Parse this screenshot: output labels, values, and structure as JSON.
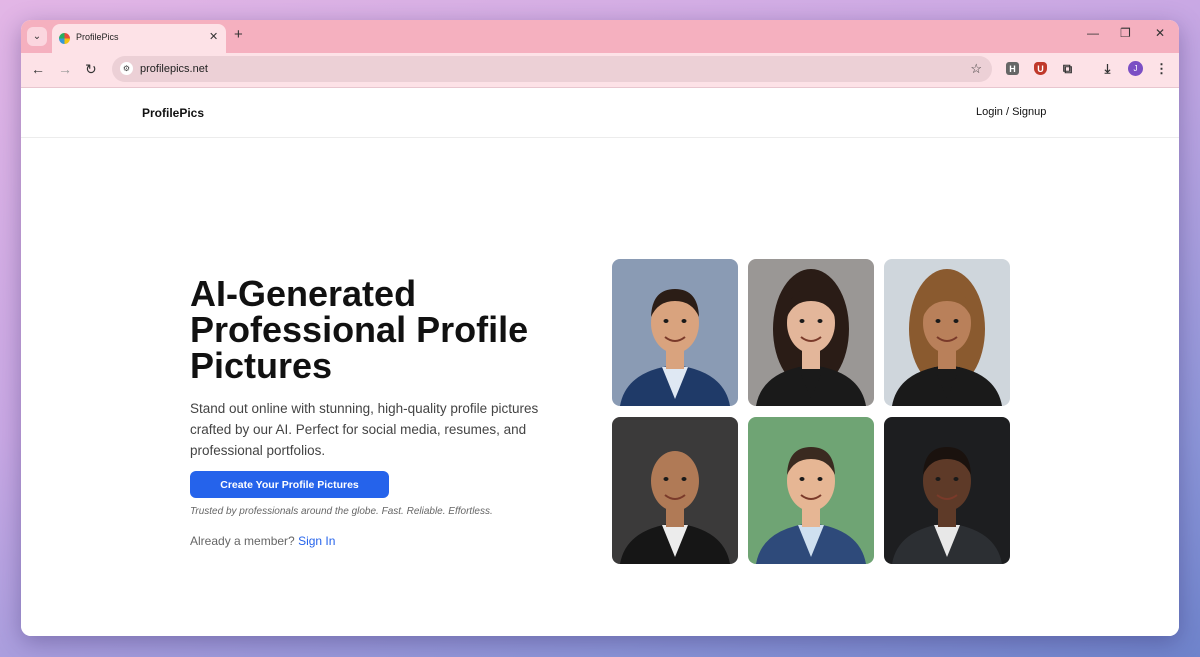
{
  "browser": {
    "tab_title": "ProfilePics",
    "url": "profilepics.net",
    "avatar_initial": "J",
    "extension_h": "H",
    "extension_shield": "U"
  },
  "site": {
    "brand": "ProfilePics",
    "login_label": "Login / Signup"
  },
  "hero": {
    "title": "AI-Generated Professional Profile Pictures",
    "subtitle": "Stand out online with stunning, high-quality profile pictures crafted by our AI. Perfect for social media, resumes, and professional portfolios.",
    "cta_label": "Create Your Profile Pictures",
    "trust_line": "Trusted by professionals around the globe. Fast. Reliable. Effortless.",
    "member_prompt": "Already a member?",
    "signin_label": "Sign In"
  },
  "colors": {
    "accent": "#2563eb",
    "tabstrip": "#f5b0bf",
    "toolbar": "#fde2e7"
  },
  "portraits": [
    {
      "name": "portrait-man-blue-suit",
      "bg": "#8a9bb4",
      "skin": "#d9a37e",
      "hair": "#2b1d16",
      "suit": "#1f3a68",
      "shirt": "#dfe8f3"
    },
    {
      "name": "portrait-woman-dark-hair",
      "bg": "#9a9795",
      "skin": "#e3b69a",
      "hair": "#2a1c16",
      "suit": "#1a1a1a",
      "shirt": "#1a1a1a"
    },
    {
      "name": "portrait-woman-wavy-hair",
      "bg": "#cfd6dc",
      "skin": "#b9805a",
      "hair": "#8a5a2f",
      "suit": "#1a1a1a",
      "shirt": "#1a1a1a"
    },
    {
      "name": "portrait-bald-man",
      "bg": "#3b3a3a",
      "skin": "#b07a56",
      "hair": "#b07a56",
      "suit": "#161616",
      "shirt": "#ececec"
    },
    {
      "name": "portrait-young-man-smiling",
      "bg": "#6fa474",
      "skin": "#e6b694",
      "hair": "#3a2a20",
      "suit": "#2e4a7a",
      "shirt": "#cfe0f0"
    },
    {
      "name": "portrait-man-gray-suit",
      "bg": "#1d1e20",
      "skin": "#5e3a28",
      "hair": "#1a120e",
      "suit": "#2c2f33",
      "shirt": "#e8e8e8"
    }
  ]
}
